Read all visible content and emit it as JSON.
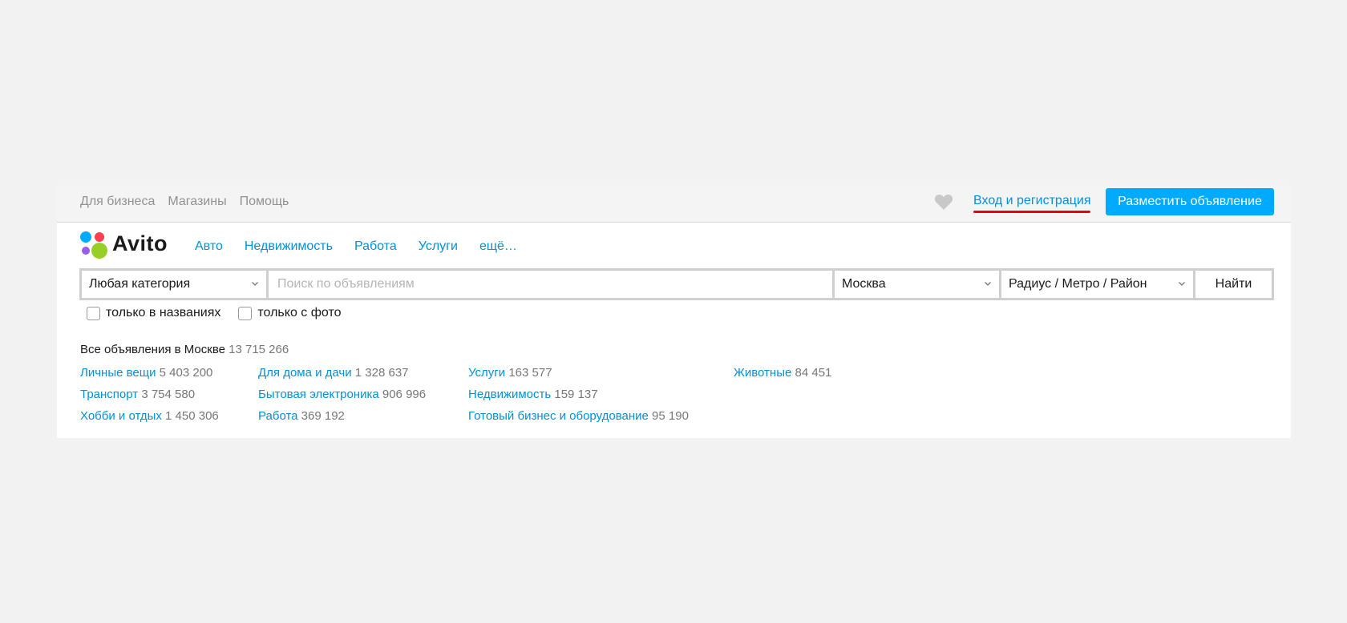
{
  "topbar": {
    "links": [
      "Для бизнеса",
      "Магазины",
      "Помощь"
    ],
    "login": "Вход и регистрация",
    "post_button": "Разместить объявление"
  },
  "logo": {
    "text": "Avito"
  },
  "main_nav": [
    "Авто",
    "Недвижимость",
    "Работа",
    "Услуги",
    "ещё…"
  ],
  "search": {
    "category": "Любая категория",
    "query_placeholder": "Поиск по объявлениям",
    "query_value": "",
    "city": "Москва",
    "radius": "Радиус / Метро / Район",
    "find_button": "Найти"
  },
  "filters": {
    "titles_only": {
      "label": "только в названиях",
      "checked": false
    },
    "with_photo": {
      "label": "только с фото",
      "checked": false
    }
  },
  "summary": {
    "label": "Все объявления в Москве",
    "count": "13 715 266"
  },
  "categories": [
    [
      {
        "name": "Личные вещи",
        "count": "5 403 200"
      },
      {
        "name": "Транспорт",
        "count": "3 754 580"
      },
      {
        "name": "Хобби и отдых",
        "count": "1 450 306"
      }
    ],
    [
      {
        "name": "Для дома и дачи",
        "count": "1 328 637"
      },
      {
        "name": "Бытовая электроника",
        "count": "906 996"
      },
      {
        "name": "Работа",
        "count": "369 192"
      }
    ],
    [
      {
        "name": "Услуги",
        "count": "163 577"
      },
      {
        "name": "Недвижимость",
        "count": "159 137"
      },
      {
        "name": "Готовый бизнес и оборудование",
        "count": "95 190"
      }
    ],
    [
      {
        "name": "Животные",
        "count": "84 451"
      }
    ]
  ],
  "colors": {
    "link": "#0091d9",
    "accent": "#00aaff",
    "highlight_underline": "#e3001b",
    "logo_dots": [
      "#00aaff",
      "#ff4053",
      "#965eeb",
      "#97cf26"
    ]
  }
}
